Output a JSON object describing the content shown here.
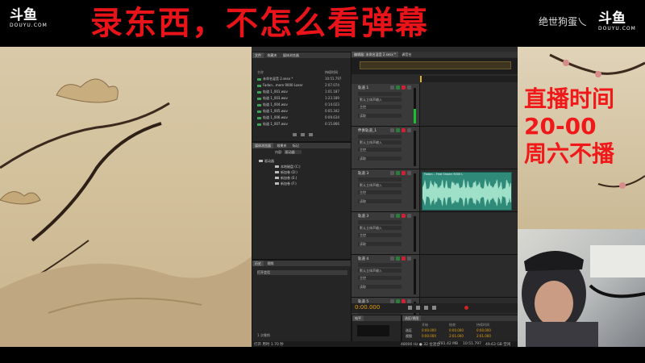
{
  "banner": {
    "title": "录东西，不怎么看弹幕",
    "logo": {
      "main": "斗鱼",
      "sub": "DOUYU.COM"
    },
    "streamer_name": "绝世狗蛋乀"
  },
  "schedule": {
    "line1": "直播时间",
    "line2": "20-00",
    "line3": "周六不播"
  },
  "app": {
    "files_panel": {
      "tabs": [
        "文件",
        "收藏夹",
        "媒体浏览器"
      ],
      "column_headers": [
        "名称",
        "持续时间"
      ],
      "items": [
        {
          "name": "未命名混音 2.sesx *",
          "duration": "10:51.797"
        },
        {
          "name": "Fadan...mere 9000 Loser",
          "duration": "2:07.074"
        },
        {
          "name": "轨道 1_001.wav",
          "duration": "1:01.187"
        },
        {
          "name": "轨道 1_003.wav",
          "duration": "1:23.189"
        },
        {
          "name": "轨道 1_004.wav",
          "duration": "0:14.023"
        },
        {
          "name": "轨道 1_005.wav",
          "duration": "0:05.342"
        },
        {
          "name": "轨道 1_006.wav",
          "duration": "0:09.634"
        },
        {
          "name": "轨道 1_007.wav",
          "duration": "0:15.866"
        }
      ]
    },
    "media_panel": {
      "tabs": [
        "媒体浏览器",
        "效果夹",
        "标记"
      ],
      "selector_label": "内容:",
      "selector_value": "驱动器",
      "tree": [
        "驱动器",
        "本地磁盘 (C:)",
        "新加卷 (D:)",
        "新加卷 (E:)",
        "新加卷 (F:)"
      ]
    },
    "history_panel": {
      "tabs": [
        "历史",
        "视频"
      ],
      "item": "打开会话"
    },
    "editor": {
      "tab": "编辑器: 未命名混音 2.sesx *",
      "mixer_tab": "调音台",
      "time_display": "0:00.000",
      "tracks": [
        {
          "name": "轨道 1",
          "input": "默认立体声输入",
          "output": "主控",
          "mode": "读取",
          "has_clip": false
        },
        {
          "name": "伴奏轨道_1",
          "input": "默认立体声输入",
          "output": "主控",
          "mode": "读取",
          "has_clip": false
        },
        {
          "name": "轨道 3",
          "input": "默认立体声输入",
          "output": "主控",
          "mode": "读取",
          "has_clip": true,
          "clip_label": "Fadan... Feat Shawn 9000 L"
        },
        {
          "name": "轨道 3",
          "input": "默认立体声输入",
          "output": "主控",
          "mode": "读取",
          "has_clip": false
        },
        {
          "name": "轨道 4",
          "input": "默认立体声输入",
          "output": "主控",
          "mode": "读取",
          "has_clip": false
        },
        {
          "name": "轨道 5",
          "input": "",
          "output": "",
          "mode": "",
          "has_clip": false
        }
      ]
    },
    "levels_panel": {
      "tab": "电平"
    },
    "selection_panel": {
      "tab": "选区/视图",
      "headers": [
        "开始",
        "结束",
        "持续时间"
      ],
      "rows": [
        {
          "label": "选区",
          "start": "0:00.000",
          "end": "0:00.000",
          "duration": "0:00.000"
        },
        {
          "label": "视图",
          "start": "0:00.000",
          "end": "2:01.000",
          "duration": "2:01.000"
        }
      ]
    },
    "status_bar": {
      "left": "打开 用时 1.70 秒",
      "sample": "48000 Hz ● 32 位混合",
      "size": "781.42 MB",
      "length": "10:51.797",
      "disk": "49.63 GB 空闲"
    },
    "undo": "1 次撤销"
  },
  "colors": {
    "title_red": "#e8141a",
    "schedule_red": "#f01818",
    "clip_teal": "#2f8a79",
    "meter_green": "#1bbf2f"
  }
}
